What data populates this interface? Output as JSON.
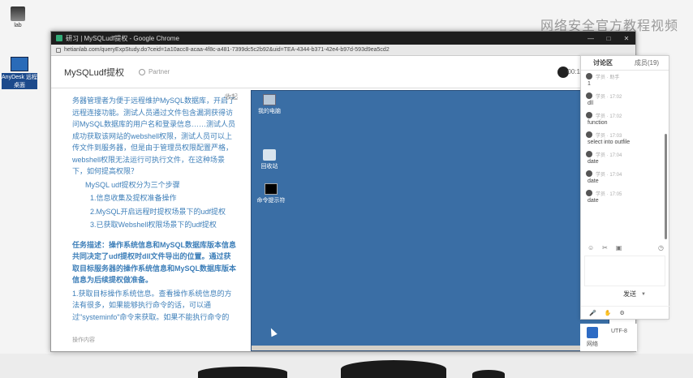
{
  "desktop": {
    "icons": [
      {
        "label": "lab"
      },
      {
        "label": "AnyDesk 远程桌面"
      }
    ],
    "watermark": "网络安全官方教程视频"
  },
  "browser": {
    "title": "研习 | MySQLudf提权 - Google Chrome",
    "url": "hetianlab.com/queryExpStudy.do?ceid=1a10acc8-acaa-4f8c-a481-7399dc5c2b92&uid=TEA-4344-b371-42e4-b97d-593d9ea5cd2",
    "window_controls": [
      "—",
      "□",
      "✕"
    ]
  },
  "page": {
    "title": "MySQLudf提权",
    "user": "Partner",
    "timer_label": "00:1",
    "collapse_label": "收起"
  },
  "instructions": {
    "paragraph": "务器管理者为便于远程维护MySQL数据库，开启了远程连接功能。测试人员通过文件包含漏洞获得访问MySQL数据库的用户名和登录信息……测试人员成功获取该网站的webshell权限，测试人员可以上传文件到服务器，但是由于管理员权限配置严格，webshell权限无法运行可执行文件，在这种场景下，如何提高权限？",
    "steps_title": "MySQL udf提权分为三个步骤",
    "steps": [
      "1.信息收集及提权准备操作",
      "2.MySQL开启远程时提权场景下的udf提权",
      "3.已获取Webshell权限场景下的udf提权"
    ],
    "task": "任务描述：操作系统信息和MySQL数据库版本信息共同决定了udf提权时dll文件导出的位置。通过获取目标服务器的操作系统信息和MySQL数据库版本信息为后续提权做准备。",
    "sub": "1.获取目标操作系统信息。查看操作系统信息的方法有很多，如果能够执行命令的话，可以通过\"systeminfo\"命令来获取。如果不能执行命令的",
    "footer": "操作内容"
  },
  "remote": {
    "icons": [
      {
        "label": "我的电脑"
      },
      {
        "label": "回收站"
      },
      {
        "label": "命令提示符"
      }
    ]
  },
  "right_bottom": {
    "label1": "网络",
    "label2": "UTF-8"
  },
  "chat": {
    "tabs": [
      "讨论区",
      "成员(19)"
    ],
    "messages": [
      {
        "user": "学员 · 助手",
        "text": "1"
      },
      {
        "user": "学员 · 17:02",
        "text": "dll"
      },
      {
        "user": "学员 · 17:02",
        "text": "function"
      },
      {
        "user": "学员 · 17:03",
        "text": "select into outfile"
      },
      {
        "user": "学员 · 17:04",
        "text": "date"
      },
      {
        "user": "学员 · 17:04",
        "text": "date"
      },
      {
        "user": "学员 · 17:05",
        "text": "date"
      }
    ],
    "tools": [
      "☺",
      "✂",
      "▣"
    ],
    "send_label": "发送",
    "bottom": [
      "🎤",
      "✋",
      "⚙"
    ]
  }
}
